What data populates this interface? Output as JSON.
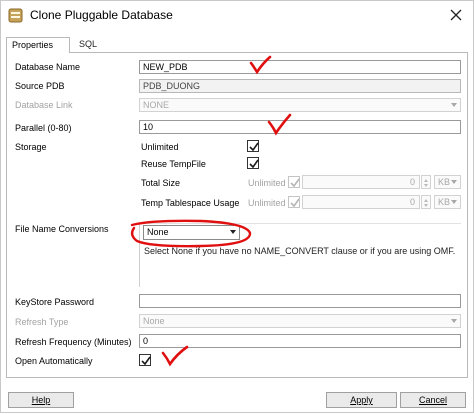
{
  "window": {
    "title": "Clone Pluggable Database",
    "icon": "database-icon",
    "close_icon": "close-icon"
  },
  "tabs": [
    {
      "label": "Properties",
      "active": true
    },
    {
      "label": "SQL",
      "active": false
    }
  ],
  "form": {
    "database_name": {
      "label": "Database Name",
      "value": "NEW_PDB"
    },
    "source_pdb": {
      "label": "Source PDB",
      "value": "PDB_DUONG"
    },
    "database_link": {
      "label": "Database Link",
      "value": "NONE"
    },
    "parallel": {
      "label": "Parallel  (0-80)",
      "value": "10"
    },
    "storage": {
      "label": "Storage",
      "unlimited": {
        "label": "Unlimited",
        "checked": true
      },
      "reuse_tempfile": {
        "label": "Reuse TempFile",
        "checked": true
      },
      "total_size": {
        "label": "Total Size",
        "unlimited_label": "Unlimited",
        "checked": true,
        "value": "0",
        "unit": "KB"
      },
      "temp_tablespace": {
        "label": "Temp Tablespace Usage",
        "unlimited_label": "Unlimited",
        "checked": true,
        "value": "0",
        "unit": "KB"
      }
    },
    "file_name_conversions": {
      "label": "File Name Conversions",
      "value": "None",
      "hint": "Select None if you have no NAME_CONVERT clause or if you are using OMF."
    },
    "keystore_password": {
      "label": "KeyStore Password",
      "value": ""
    },
    "refresh_type": {
      "label": "Refresh Type",
      "value": "None"
    },
    "refresh_frequency": {
      "label": "Refresh Frequency (Minutes)",
      "value": "0"
    },
    "open_automatically": {
      "label": "Open Automatically",
      "checked": true
    }
  },
  "buttons": {
    "help": "Help",
    "apply": "Apply",
    "cancel": "Cancel"
  },
  "colors": {
    "annotation": "#e01010",
    "checkmark": "#1a1a1a",
    "panel_border": "#b9b9b9"
  }
}
